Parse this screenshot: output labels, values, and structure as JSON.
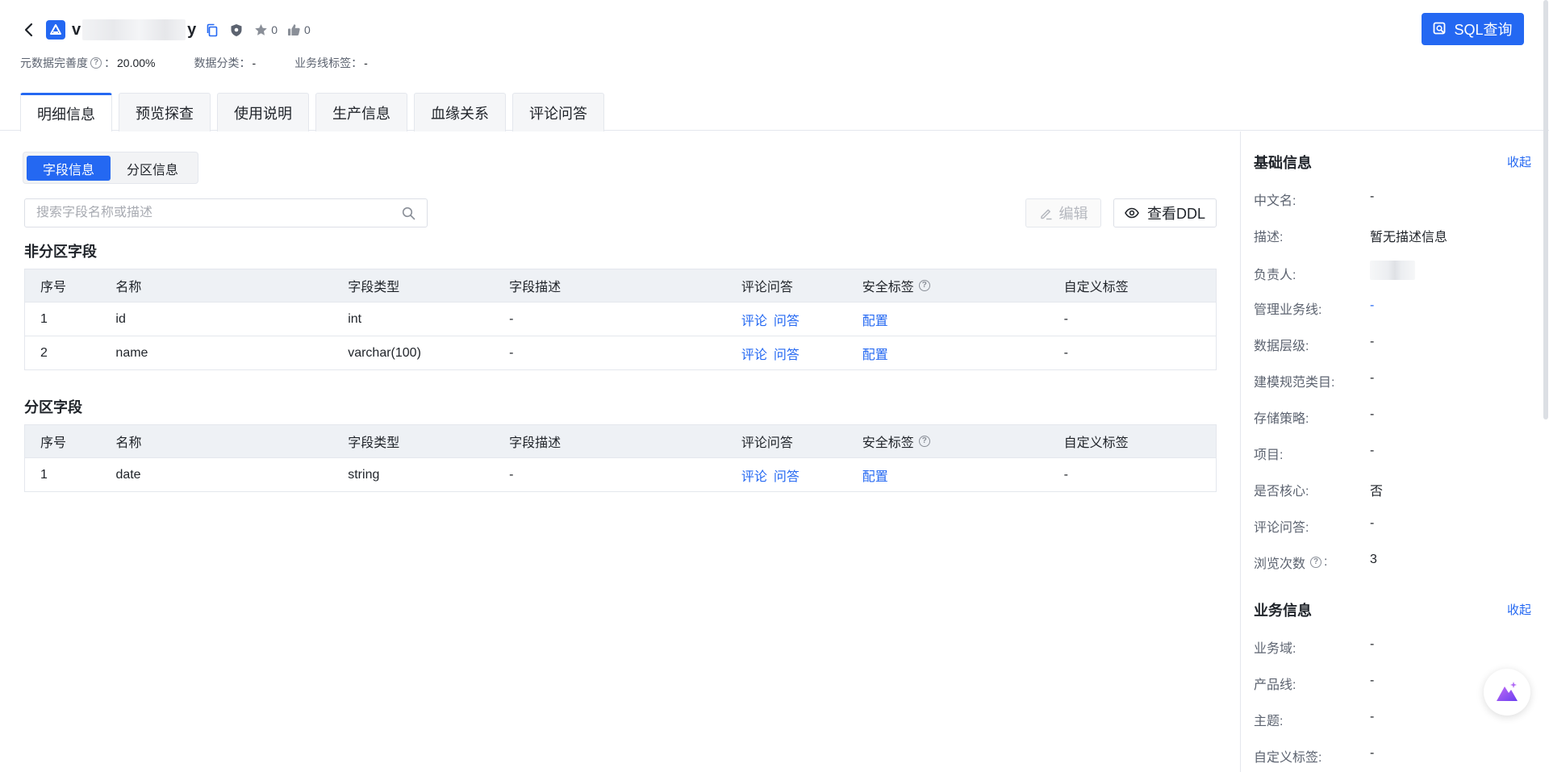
{
  "header": {
    "title_prefix": "v",
    "title_suffix": "y",
    "star_count": "0",
    "like_count": "0",
    "sql_button_label": "SQL查询",
    "meta": {
      "completeness_label": "元数据完善度",
      "completeness_value": "20.00%",
      "category_label": "数据分类：",
      "category_value": "-",
      "bizline_tag_label": "业务线标签：",
      "bizline_tag_value": "-"
    },
    "tabs": [
      {
        "label": "明细信息",
        "active": true
      },
      {
        "label": "预览探查",
        "active": false
      },
      {
        "label": "使用说明",
        "active": false
      },
      {
        "label": "生产信息",
        "active": false
      },
      {
        "label": "血缘关系",
        "active": false
      },
      {
        "label": "评论问答",
        "active": false
      }
    ]
  },
  "main": {
    "segments": [
      "字段信息",
      "分区信息"
    ],
    "search_placeholder": "搜索字段名称或描述",
    "edit_label": "编辑",
    "ddl_label": "查看DDL",
    "columns": [
      "序号",
      "名称",
      "字段类型",
      "字段描述",
      "评论问答",
      "安全标签",
      "自定义标签"
    ],
    "comment_link": "评论",
    "qa_link": "问答",
    "config_link": "配置",
    "non_partition": {
      "title": "非分区字段",
      "rows": [
        {
          "no": "1",
          "name": "id",
          "type": "int",
          "desc": "-",
          "custom": "-"
        },
        {
          "no": "2",
          "name": "name",
          "type": "varchar(100)",
          "desc": "-",
          "custom": "-"
        }
      ]
    },
    "partition": {
      "title": "分区字段",
      "rows": [
        {
          "no": "1",
          "name": "date",
          "type": "string",
          "desc": "-",
          "custom": "-"
        }
      ]
    }
  },
  "right_panel": {
    "collapse_label": "收起",
    "basic": {
      "title": "基础信息",
      "rows": [
        {
          "label": "中文名:",
          "value": "-"
        },
        {
          "label": "描述:",
          "value": "暂无描述信息"
        },
        {
          "label": "负责人:",
          "value": ""
        },
        {
          "label": "管理业务线:",
          "value": "-"
        },
        {
          "label": "数据层级:",
          "value": "-"
        },
        {
          "label": "建模规范类目:",
          "value": "-"
        },
        {
          "label": "存储策略:",
          "value": "-"
        },
        {
          "label": "项目:",
          "value": "-"
        },
        {
          "label": "是否核心:",
          "value": "否"
        },
        {
          "label": "评论问答:",
          "value": "-"
        },
        {
          "label": "浏览次数",
          "value": "3"
        }
      ]
    },
    "business": {
      "title": "业务信息",
      "rows": [
        {
          "label": "业务域:",
          "value": "-"
        },
        {
          "label": "产品线:",
          "value": "-"
        },
        {
          "label": "主题:",
          "value": "-"
        },
        {
          "label": "自定义标签:",
          "value": "-"
        }
      ]
    }
  },
  "colors": {
    "primary": "#2468f2",
    "table_header_bg": "#eef1f5",
    "border": "#e4e7ed"
  }
}
